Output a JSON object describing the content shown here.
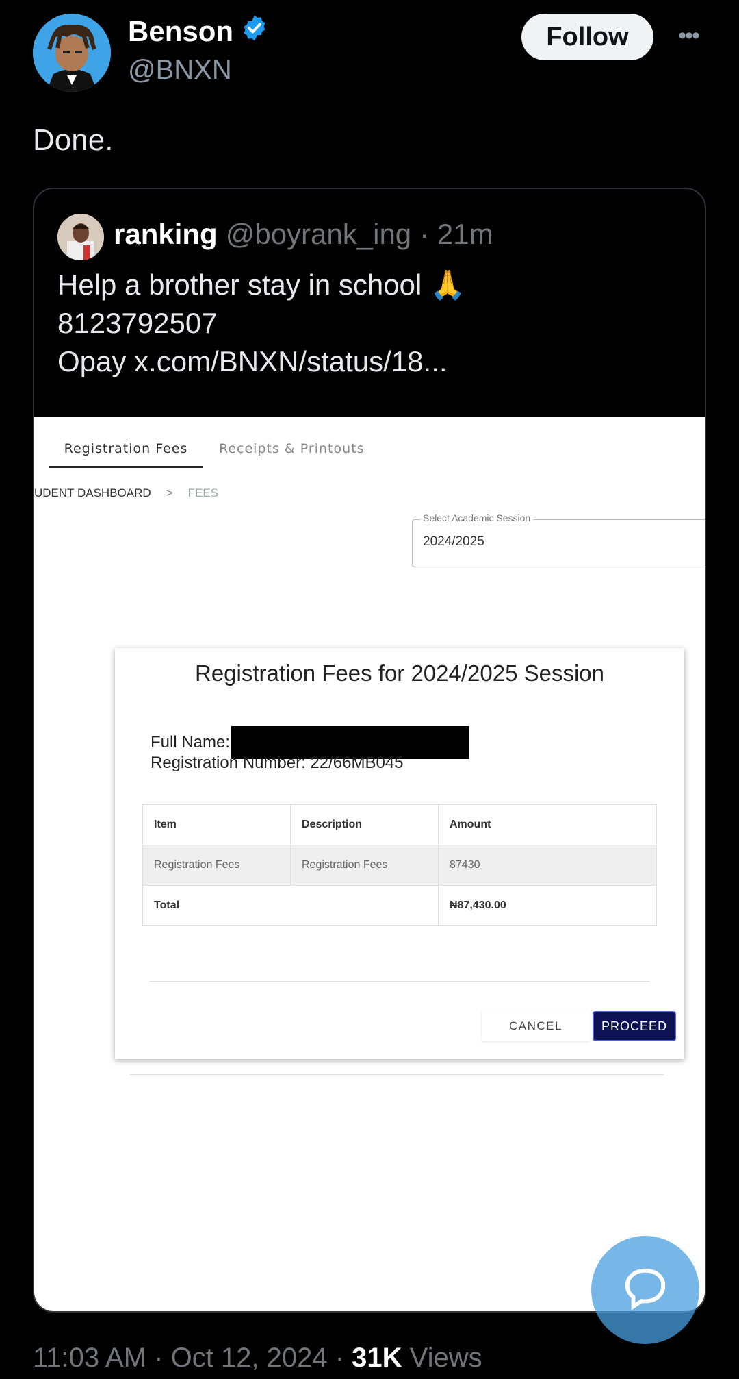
{
  "author": {
    "name": "Benson",
    "handle": "@BNXN",
    "verified": true,
    "follow_label": "Follow",
    "more_label": "•••"
  },
  "tweet": {
    "text": "Done."
  },
  "quoted": {
    "name": "ranking",
    "handle": "@boyrank_ing",
    "time": "· 21m",
    "line1": "Help a brother stay in school 🙏",
    "line2": "8123792507",
    "line3": "Opay  x.com/BNXN/status/18..."
  },
  "screenshot": {
    "tabs": [
      {
        "label": "Registration Fees",
        "active": true
      },
      {
        "label": "Receipts & Printouts",
        "active": false
      }
    ],
    "breadcrumb": [
      "UDENT DASHBOARD",
      ">",
      "FEES"
    ],
    "session": {
      "label": "Select Academic Session",
      "value": "2024/2025"
    },
    "modal": {
      "title": "Registration Fees for 2024/2025 Session",
      "full_name_label": "Full Name:",
      "reg_number": "Registration Number: 22/66MB045",
      "headers": [
        "Item",
        "Description",
        "Amount"
      ],
      "row": [
        "Registration Fees",
        "Registration Fees",
        "87430"
      ],
      "total_label": "Total",
      "total_value": "₦87,430.00",
      "cancel_label": "CANCEL",
      "proceed_label": "PROCEED"
    }
  },
  "footer": {
    "time": "11:03 AM · Oct 12, 2024 · ",
    "views_count": "31K",
    "views_label": " Views"
  },
  "colors": {
    "background": "#000000",
    "verified": "#1d9bf0",
    "proceed": "#0d1254"
  }
}
